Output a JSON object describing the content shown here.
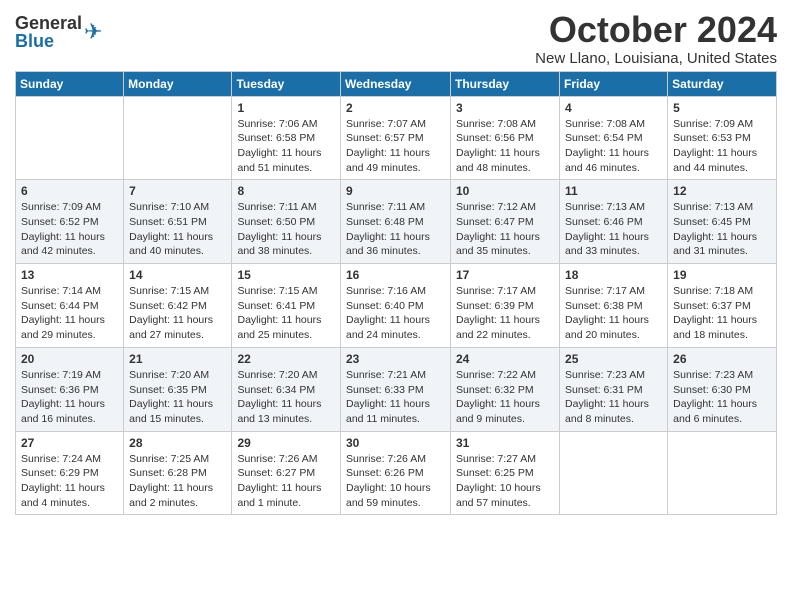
{
  "logo": {
    "general": "General",
    "blue": "Blue"
  },
  "title": {
    "month": "October 2024",
    "location": "New Llano, Louisiana, United States"
  },
  "header_days": [
    "Sunday",
    "Monday",
    "Tuesday",
    "Wednesday",
    "Thursday",
    "Friday",
    "Saturday"
  ],
  "weeks": [
    [
      {
        "day": "",
        "text": ""
      },
      {
        "day": "",
        "text": ""
      },
      {
        "day": "1",
        "text": "Sunrise: 7:06 AM\nSunset: 6:58 PM\nDaylight: 11 hours and 51 minutes."
      },
      {
        "day": "2",
        "text": "Sunrise: 7:07 AM\nSunset: 6:57 PM\nDaylight: 11 hours and 49 minutes."
      },
      {
        "day": "3",
        "text": "Sunrise: 7:08 AM\nSunset: 6:56 PM\nDaylight: 11 hours and 48 minutes."
      },
      {
        "day": "4",
        "text": "Sunrise: 7:08 AM\nSunset: 6:54 PM\nDaylight: 11 hours and 46 minutes."
      },
      {
        "day": "5",
        "text": "Sunrise: 7:09 AM\nSunset: 6:53 PM\nDaylight: 11 hours and 44 minutes."
      }
    ],
    [
      {
        "day": "6",
        "text": "Sunrise: 7:09 AM\nSunset: 6:52 PM\nDaylight: 11 hours and 42 minutes."
      },
      {
        "day": "7",
        "text": "Sunrise: 7:10 AM\nSunset: 6:51 PM\nDaylight: 11 hours and 40 minutes."
      },
      {
        "day": "8",
        "text": "Sunrise: 7:11 AM\nSunset: 6:50 PM\nDaylight: 11 hours and 38 minutes."
      },
      {
        "day": "9",
        "text": "Sunrise: 7:11 AM\nSunset: 6:48 PM\nDaylight: 11 hours and 36 minutes."
      },
      {
        "day": "10",
        "text": "Sunrise: 7:12 AM\nSunset: 6:47 PM\nDaylight: 11 hours and 35 minutes."
      },
      {
        "day": "11",
        "text": "Sunrise: 7:13 AM\nSunset: 6:46 PM\nDaylight: 11 hours and 33 minutes."
      },
      {
        "day": "12",
        "text": "Sunrise: 7:13 AM\nSunset: 6:45 PM\nDaylight: 11 hours and 31 minutes."
      }
    ],
    [
      {
        "day": "13",
        "text": "Sunrise: 7:14 AM\nSunset: 6:44 PM\nDaylight: 11 hours and 29 minutes."
      },
      {
        "day": "14",
        "text": "Sunrise: 7:15 AM\nSunset: 6:42 PM\nDaylight: 11 hours and 27 minutes."
      },
      {
        "day": "15",
        "text": "Sunrise: 7:15 AM\nSunset: 6:41 PM\nDaylight: 11 hours and 25 minutes."
      },
      {
        "day": "16",
        "text": "Sunrise: 7:16 AM\nSunset: 6:40 PM\nDaylight: 11 hours and 24 minutes."
      },
      {
        "day": "17",
        "text": "Sunrise: 7:17 AM\nSunset: 6:39 PM\nDaylight: 11 hours and 22 minutes."
      },
      {
        "day": "18",
        "text": "Sunrise: 7:17 AM\nSunset: 6:38 PM\nDaylight: 11 hours and 20 minutes."
      },
      {
        "day": "19",
        "text": "Sunrise: 7:18 AM\nSunset: 6:37 PM\nDaylight: 11 hours and 18 minutes."
      }
    ],
    [
      {
        "day": "20",
        "text": "Sunrise: 7:19 AM\nSunset: 6:36 PM\nDaylight: 11 hours and 16 minutes."
      },
      {
        "day": "21",
        "text": "Sunrise: 7:20 AM\nSunset: 6:35 PM\nDaylight: 11 hours and 15 minutes."
      },
      {
        "day": "22",
        "text": "Sunrise: 7:20 AM\nSunset: 6:34 PM\nDaylight: 11 hours and 13 minutes."
      },
      {
        "day": "23",
        "text": "Sunrise: 7:21 AM\nSunset: 6:33 PM\nDaylight: 11 hours and 11 minutes."
      },
      {
        "day": "24",
        "text": "Sunrise: 7:22 AM\nSunset: 6:32 PM\nDaylight: 11 hours and 9 minutes."
      },
      {
        "day": "25",
        "text": "Sunrise: 7:23 AM\nSunset: 6:31 PM\nDaylight: 11 hours and 8 minutes."
      },
      {
        "day": "26",
        "text": "Sunrise: 7:23 AM\nSunset: 6:30 PM\nDaylight: 11 hours and 6 minutes."
      }
    ],
    [
      {
        "day": "27",
        "text": "Sunrise: 7:24 AM\nSunset: 6:29 PM\nDaylight: 11 hours and 4 minutes."
      },
      {
        "day": "28",
        "text": "Sunrise: 7:25 AM\nSunset: 6:28 PM\nDaylight: 11 hours and 2 minutes."
      },
      {
        "day": "29",
        "text": "Sunrise: 7:26 AM\nSunset: 6:27 PM\nDaylight: 11 hours and 1 minute."
      },
      {
        "day": "30",
        "text": "Sunrise: 7:26 AM\nSunset: 6:26 PM\nDaylight: 10 hours and 59 minutes."
      },
      {
        "day": "31",
        "text": "Sunrise: 7:27 AM\nSunset: 6:25 PM\nDaylight: 10 hours and 57 minutes."
      },
      {
        "day": "",
        "text": ""
      },
      {
        "day": "",
        "text": ""
      }
    ]
  ]
}
